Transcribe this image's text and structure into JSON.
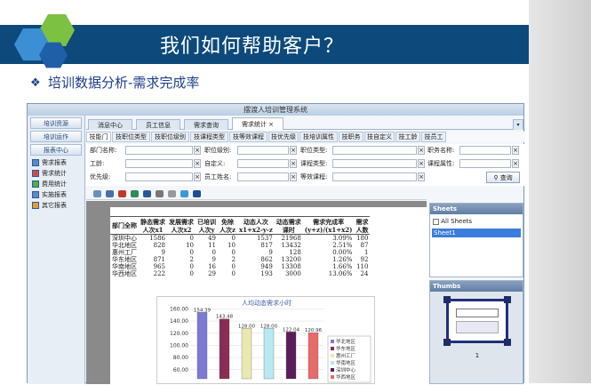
{
  "slide": {
    "title": "我们如何帮助客户？",
    "subtitle": "培训数据分析-需求完成率",
    "bullet": "❖",
    "colors": {
      "banner": "#0d4a7b",
      "hex_green": "#7cc142",
      "hex_blue": "#3d8fd4",
      "hex_dark": "#1f5fa8"
    }
  },
  "app": {
    "title": "摆渡人培训管理系统",
    "sidebar": {
      "buttons": [
        "培训资源",
        "培训运作",
        "报表中心"
      ],
      "items": [
        "需求报表",
        "需求统计",
        "费用统计",
        "实施报表",
        "其它报表"
      ]
    },
    "tabs": [
      {
        "label": "消息中心"
      },
      {
        "label": "员工信息"
      },
      {
        "label": "需求查询"
      },
      {
        "label": "需求统计",
        "close": "×"
      }
    ],
    "subtabs": [
      "技能门",
      "技职位类型",
      "技职位级别",
      "技课程类型",
      "技等效课程",
      "技优先级",
      "技培训属性",
      "技职务",
      "技自定义",
      "技工龄",
      "技员工"
    ],
    "filters": {
      "dept": "部门名称:",
      "job_level": "职位级别:",
      "job_type": "职位类型:",
      "position": "职务名称:",
      "seniority": "工龄:",
      "custom": "自定义:",
      "course_type": "课程类型:",
      "course_attr": "课程属性:",
      "priority": "优先级:",
      "employee": "员工姓名:",
      "equiv": "等效课程:",
      "query": "查询",
      "x": "×"
    },
    "report": {
      "headers": [
        "部门全称",
        "静态需求\n人次x1",
        "发展需求\n人次x2",
        "已培训\n人次y",
        "免除\n人次z",
        "动态人次\nx1+x2-y-z",
        "动态需求\n课时",
        "需求完成率\n(y+z)/(x1+x2)",
        "需求\n人数"
      ],
      "rows": [
        [
          "深圳中心",
          "1586",
          "0",
          "49",
          "0",
          "1537",
          "21968",
          "3.09%",
          "180"
        ],
        [
          "华北地区",
          "828",
          "10",
          "11",
          "10",
          "817",
          "13432",
          "2.51%",
          "87"
        ],
        [
          "惠州工厂",
          "9",
          "0",
          "0",
          "0",
          "9",
          "128",
          "0.00%",
          "1"
        ],
        [
          "华东地区",
          "871",
          "2",
          "9",
          "2",
          "862",
          "13200",
          "1.26%",
          "92"
        ],
        [
          "华南地区",
          "965",
          "0",
          "16",
          "0",
          "949",
          "13308",
          "1.66%",
          "110"
        ],
        [
          "华西地区",
          "222",
          "0",
          "29",
          "0",
          "193",
          "3000",
          "13.06%",
          "24"
        ]
      ]
    },
    "sheets": {
      "title": "Sheets",
      "all": "All Sheets",
      "items": [
        "Sheet1"
      ]
    },
    "thumbs": {
      "title": "Thumbs",
      "page": "1"
    }
  },
  "chart_data": {
    "type": "bar",
    "title": "人均动态需求小时",
    "categories": [
      "华北地区",
      "华东地区",
      "惠州工厂",
      "华南地区",
      "深圳中心",
      "华西地区"
    ],
    "values": [
      154.39,
      143.48,
      128.0,
      128.0,
      122.04,
      120.96
    ],
    "value_labels": [
      "154.39",
      "143.48",
      "128.00",
      "128.00",
      "122.04",
      "120.96"
    ],
    "colors": [
      "#7b7bd6",
      "#8a2d55",
      "#e8e8b0",
      "#b8e8f0",
      "#5a1d5a",
      "#e86a6a"
    ],
    "yticks": [
      "160.00",
      "140.00",
      "120.00",
      "100.00",
      "80.00",
      "60.00"
    ],
    "ylim": [
      45,
      165
    ],
    "legend": [
      "华北地区",
      "华东地区",
      "惠州工厂",
      "华南地区",
      "深圳中心",
      "华西地区"
    ],
    "legend_placement": "right"
  }
}
